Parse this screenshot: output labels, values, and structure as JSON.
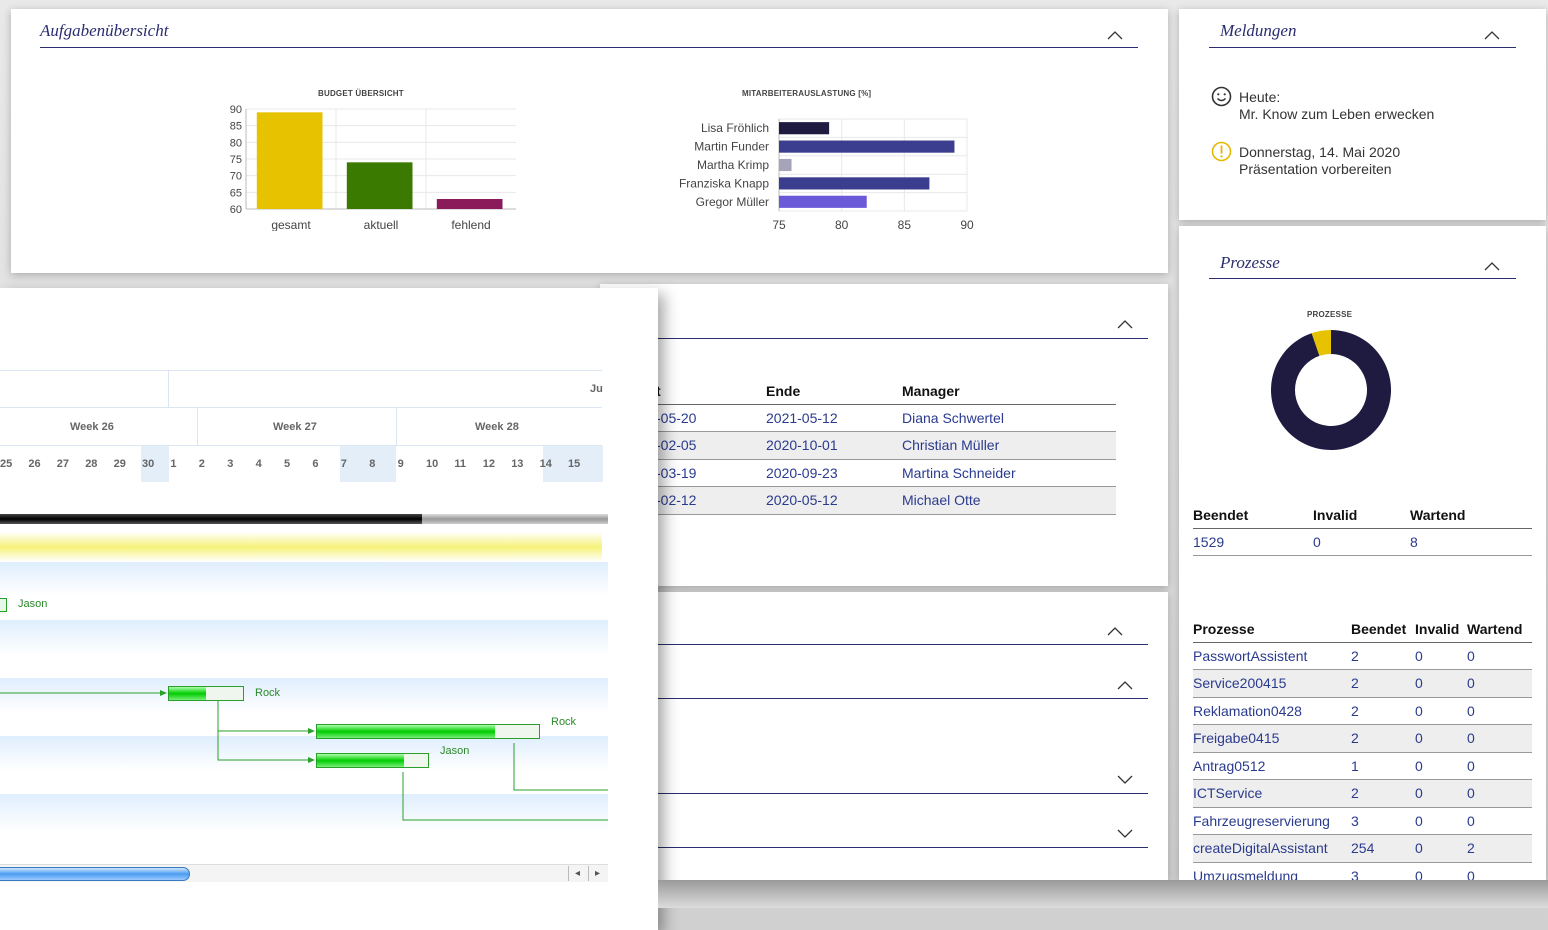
{
  "task_overview": {
    "title": "Aufgabenübersicht",
    "budget_chart": {
      "title": "BUDGET ÜBERSICHT",
      "y_ticks": [
        "90",
        "85",
        "80",
        "75",
        "70",
        "65",
        "60"
      ]
    },
    "workload_chart": {
      "title": "MITARBEITERAUSLASTUNG [%]",
      "x_ticks": [
        "75",
        "80",
        "85",
        "90"
      ]
    }
  },
  "chart_data": [
    {
      "type": "bar",
      "title": "BUDGET ÜBERSICHT",
      "categories": [
        "gesamt",
        "aktuell",
        "fehlend"
      ],
      "values": [
        89,
        74,
        63
      ],
      "colors": [
        "#e6c200",
        "#3a7a00",
        "#8a1a5a"
      ],
      "ylim": [
        60,
        90
      ]
    },
    {
      "type": "bar",
      "orientation": "horizontal",
      "title": "MITARBEITERAUSLASTUNG [%]",
      "categories": [
        "Lisa Fröhlich",
        "Martin Funder",
        "Martha Krimp",
        "Franziska Knapp",
        "Gregor Müller"
      ],
      "values": [
        79,
        89,
        76,
        87,
        82
      ],
      "colors": [
        "#1e1a40",
        "#3b3d8e",
        "#a6a4b8",
        "#3b3d8e",
        "#6a5ad8"
      ],
      "xlim": [
        75,
        90
      ]
    },
    {
      "type": "pie",
      "title": "PROZESSE",
      "categories": [
        "Beendet",
        "Invalid",
        "Wartend"
      ],
      "values": [
        1529,
        0,
        8
      ],
      "colors": [
        "#1e1a40",
        "#7a7a7a",
        "#e6c200"
      ]
    }
  ],
  "notifications": {
    "title": "Meldungen",
    "items": [
      {
        "icon": "smiley-icon",
        "line1": "Heute:",
        "line2": "Mr. Know zum Leben erwecken"
      },
      {
        "icon": "warning-icon",
        "line1": "Donnerstag, 14. Mai 2020",
        "line2": "Präsentation vorbereiten"
      }
    ]
  },
  "processes": {
    "title": "Prozesse",
    "chart_title": "PROZESSE",
    "summary_headers": [
      "Beendet",
      "Invalid",
      "Wartend"
    ],
    "summary_values": [
      "1529",
      "0",
      "8"
    ],
    "table_headers": [
      "Prozesse",
      "Beendet",
      "Invalid",
      "Wartend"
    ],
    "rows": [
      [
        "PasswortAssistent",
        "2",
        "0",
        "0"
      ],
      [
        "Service200415",
        "2",
        "0",
        "0"
      ],
      [
        "Reklamation0428",
        "2",
        "0",
        "0"
      ],
      [
        "Freigabe0415",
        "2",
        "0",
        "0"
      ],
      [
        "Antrag0512",
        "1",
        "0",
        "0"
      ],
      [
        "ICTService",
        "2",
        "0",
        "0"
      ],
      [
        "Fahrzeugreservierung",
        "3",
        "0",
        "0"
      ],
      [
        "createDigitalAssistant",
        "254",
        "0",
        "2"
      ],
      [
        "Umzugsmeldung",
        "3",
        "0",
        "0"
      ]
    ]
  },
  "projects": {
    "headers": [
      "t",
      "Ende",
      "Manager"
    ],
    "rows": [
      [
        "-05-20",
        "2021-05-12",
        "Diana Schwertel"
      ],
      [
        "-02-05",
        "2020-10-01",
        "Christian Müller"
      ],
      [
        "-03-19",
        "2020-09-23",
        "Martina Schneider"
      ],
      [
        "-02-12",
        "2020-05-12",
        "Michael Otte"
      ]
    ]
  },
  "gantt": {
    "month_label": "Ju",
    "weeks": [
      "Week 26",
      "Week 27",
      "Week 28"
    ],
    "days": [
      "25",
      "26",
      "27",
      "28",
      "29",
      "30",
      "1",
      "2",
      "3",
      "4",
      "5",
      "6",
      "7",
      "8",
      "9",
      "10",
      "11",
      "12",
      "13",
      "14",
      "15"
    ],
    "resources": [
      "Jason",
      "Rock",
      "Rock",
      "Jason"
    ],
    "scroll_left": "◂",
    "scroll_right": "▸"
  }
}
